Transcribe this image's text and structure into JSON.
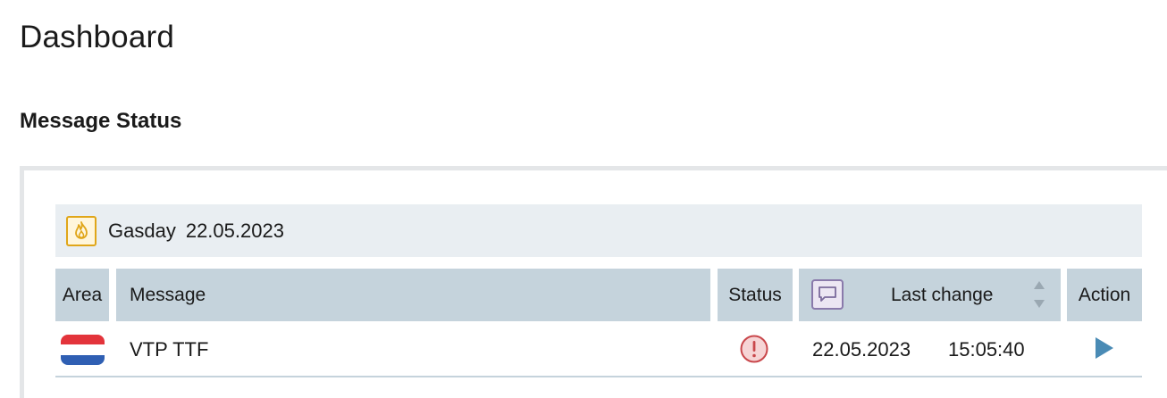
{
  "page": {
    "title": "Dashboard",
    "section_title": "Message Status"
  },
  "gasday": {
    "label": "Gasday",
    "date": "22.05.2023",
    "icon": "flame-icon"
  },
  "table": {
    "columns": {
      "area": "Area",
      "message": "Message",
      "status": "Status",
      "last_change": "Last change",
      "action": "Action"
    },
    "rows": [
      {
        "area_flag": "netherlands-flag-icon",
        "message": "VTP TTF",
        "status": "error",
        "date": "22.05.2023",
        "time": "15:05:40",
        "action_icon": "play-icon"
      }
    ]
  },
  "colors": {
    "header_bg": "#c5d3dc",
    "gasday_bg": "#e9eef2",
    "accent_flame": "#e0a619",
    "status_error": "#c9474b",
    "action_play": "#4a8bb5"
  }
}
